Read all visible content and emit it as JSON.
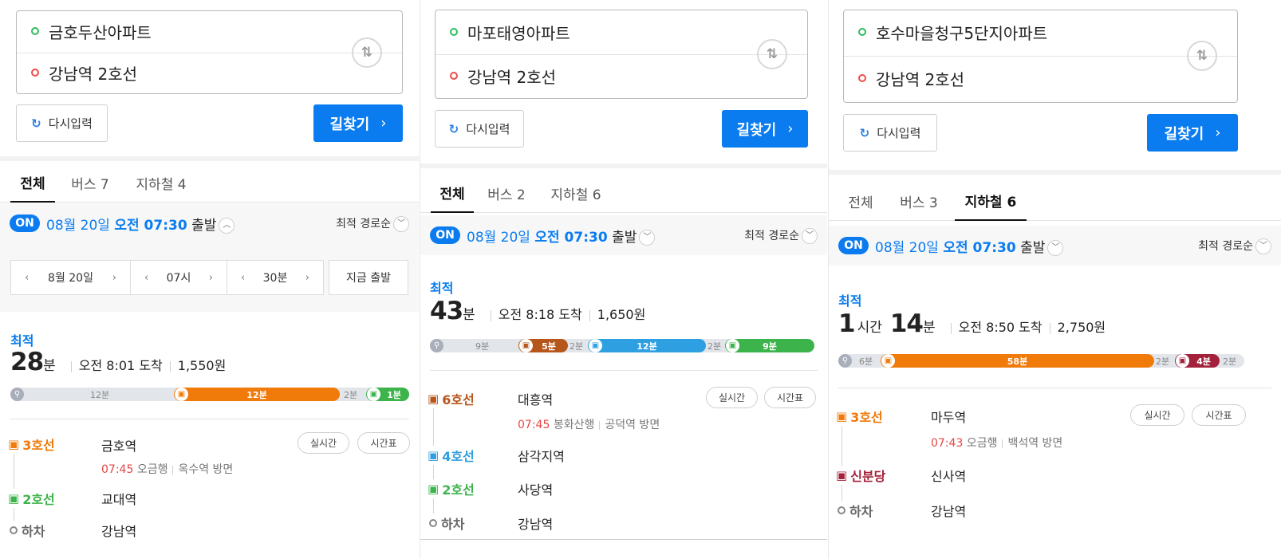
{
  "panels": [
    {
      "origin": "금호두산아파트",
      "destination": "강남역 2호선",
      "reset_label": "다시입력",
      "search_label": "길찾기",
      "tabs": [
        "전체",
        "버스 7",
        "지하철 4"
      ],
      "active_tab": 0,
      "on_label": "ON",
      "dep_date": "08월 20일",
      "dep_time": "오전 07:30",
      "dep_suffix": "출발",
      "sort_label": "최적 경로순",
      "time_selector": {
        "month_day": "8월 20일",
        "hour": "07시",
        "minute": "30분",
        "now_label": "지금 출발"
      },
      "best_label": "최적",
      "duration_hours": "",
      "duration_hours_unit": "",
      "duration_minutes": "28",
      "duration_minutes_unit": "분",
      "arrival": "오전 8:01 도착",
      "fare": "1,550원",
      "timeline": {
        "walk": "12분",
        "segs": [
          {
            "label": "12분",
            "color": "#f07a0a",
            "share": 0.49
          }
        ],
        "transfer_gap": "2분",
        "last": {
          "label": "1분",
          "color": "#3cb44b"
        }
      },
      "steps": [
        {
          "line": "3호선",
          "color": "#f07a0a",
          "station": "금호역",
          "time": "07:45",
          "direction1": "오금행",
          "direction2": "옥수역 방면",
          "realtime_label": "실시간",
          "timetable_label": "시간표"
        },
        {
          "line": "2호선",
          "color": "#3cb44b",
          "station": "교대역"
        },
        {
          "line": "하차",
          "color": "#666666",
          "station": "강남역"
        }
      ]
    },
    {
      "origin": "마포태영아파트",
      "destination": "강남역 2호선",
      "reset_label": "다시입력",
      "search_label": "길찾기",
      "tabs": [
        "전체",
        "버스 2",
        "지하철 6"
      ],
      "active_tab": 0,
      "on_label": "ON",
      "dep_date": "08월 20일",
      "dep_time": "오전 07:30",
      "dep_suffix": "출발",
      "sort_label": "최적 경로순",
      "best_label": "최적",
      "duration_hours": "",
      "duration_hours_unit": "",
      "duration_minutes": "43",
      "duration_minutes_unit": "분",
      "arrival": "오전 8:18 도착",
      "fare": "1,650원",
      "timeline": {
        "walk": "9분",
        "segs": [
          {
            "label": "5분",
            "color": "#b7561b"
          },
          {
            "label": "12분",
            "color": "#2e9fe0"
          }
        ],
        "transfer_gap": "2분",
        "transfer_gap2": "2분",
        "last": {
          "label": "9분",
          "color": "#3cb44b"
        }
      },
      "steps": [
        {
          "line": "6호선",
          "color": "#b7561b",
          "station": "대흥역",
          "time": "07:45",
          "direction1": "봉화산행",
          "direction2": "공덕역 방면",
          "realtime_label": "실시간",
          "timetable_label": "시간표"
        },
        {
          "line": "4호선",
          "color": "#2e9fe0",
          "station": "삼각지역"
        },
        {
          "line": "2호선",
          "color": "#3cb44b",
          "station": "사당역"
        },
        {
          "line": "하차",
          "color": "#666666",
          "station": "강남역"
        }
      ]
    },
    {
      "origin": "호수마을청구5단지아파트",
      "destination": "강남역 2호선",
      "reset_label": "다시입력",
      "search_label": "길찾기",
      "tabs": [
        "전체",
        "버스 3",
        "지하철 6"
      ],
      "active_tab": 2,
      "on_label": "ON",
      "dep_date": "08월 20일",
      "dep_time": "오전 07:30",
      "dep_suffix": "출발",
      "sort_label": "최적 경로순",
      "best_label": "최적",
      "duration_hours": "1",
      "duration_hours_unit": "시간",
      "duration_minutes": "14",
      "duration_minutes_unit": "분",
      "arrival": "오전 8:50 도착",
      "fare": "2,750원",
      "timeline": {
        "walk": "6분",
        "segs": [
          {
            "label": "58분",
            "color": "#f07a0a"
          }
        ],
        "transfer_gap": "2분",
        "last": {
          "label": "4분",
          "color": "#a3213a"
        },
        "tail": "2분"
      },
      "steps": [
        {
          "line": "3호선",
          "color": "#f07a0a",
          "station": "마두역",
          "time": "07:43",
          "direction1": "오금행",
          "direction2": "백석역 방면",
          "realtime_label": "실시간",
          "timetable_label": "시간표"
        },
        {
          "line": "신분당",
          "color": "#a3213a",
          "station": "신사역"
        },
        {
          "line": "하차",
          "color": "#666666",
          "station": "강남역"
        }
      ]
    }
  ],
  "icons": {
    "walk": "walk-icon",
    "train": "train-icon",
    "swap": "swap-icon",
    "refresh": "refresh-icon"
  },
  "colors": {
    "accent": "#0a7cf0",
    "time_red": "#e64545"
  }
}
